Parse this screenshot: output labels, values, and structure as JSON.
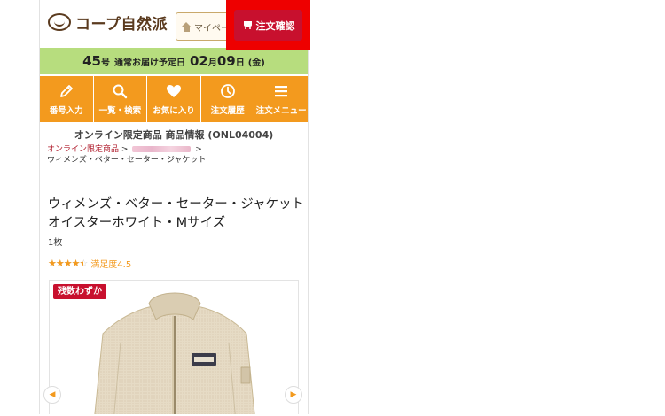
{
  "header": {
    "logo_text": "コープ自然派",
    "mypage_label": "マイページ",
    "order_label": "注文確認"
  },
  "delivery": {
    "issue_number": "45",
    "issue_suffix": "号",
    "label": "通常お届け予定日",
    "month": "02",
    "month_suffix": "月",
    "day": "09",
    "day_suffix": "日",
    "weekday": "(金)"
  },
  "nav": [
    {
      "label": "番号入力",
      "icon": "pencil-icon"
    },
    {
      "label": "一覧・検索",
      "icon": "search-icon"
    },
    {
      "label": "お気に入り",
      "icon": "heart-icon"
    },
    {
      "label": "注文履歴",
      "icon": "clock-icon"
    },
    {
      "label": "注文メニュー",
      "icon": "menu-icon"
    }
  ],
  "product": {
    "info_title": "オンライン限定商品 商品情報 (ONL04004)",
    "breadcrumb": {
      "link1": "オンライン限定商品",
      "sep": ">",
      "current": "ウィメンズ・ベター・セーター・ジャケット"
    },
    "name_line1": "ウィメンズ・ベター・セーター・ジャケット",
    "name_line2": "オイスターホワイト・Mサイズ",
    "quantity": "1枚",
    "rating_value": 4.5,
    "rating_max": 5,
    "rating_text": "満足度4.5",
    "badge": "残数わずか"
  },
  "colors": {
    "accent_orange": "#f39a1e",
    "brand_red": "#c8102e",
    "highlight_red": "#ee0000",
    "delivery_green": "#b7dd7e"
  }
}
